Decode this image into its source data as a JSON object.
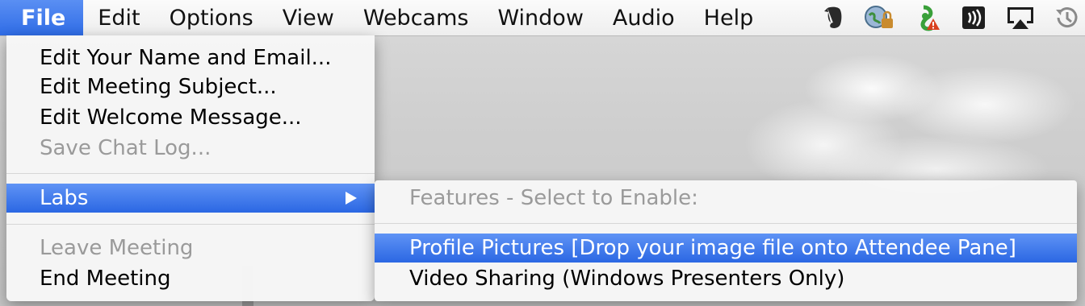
{
  "menubar": {
    "items": [
      {
        "label": "File"
      },
      {
        "label": "Edit"
      },
      {
        "label": "Options"
      },
      {
        "label": "View"
      },
      {
        "label": "Webcams"
      },
      {
        "label": "Window"
      },
      {
        "label": "Audio"
      },
      {
        "label": "Help"
      }
    ],
    "status_icons": [
      "evernote-icon",
      "network-lock-icon",
      "sync-warning-icon",
      "volume-icon",
      "airplay-icon",
      "time-machine-icon"
    ]
  },
  "file_menu": {
    "items": [
      {
        "label": "Edit Your Name and Email...",
        "enabled": true
      },
      {
        "label": "Edit Meeting Subject...",
        "enabled": true
      },
      {
        "label": "Edit Welcome Message...",
        "enabled": true
      },
      {
        "label": "Save Chat Log...",
        "enabled": false
      },
      {
        "label": "Labs",
        "enabled": true,
        "highlighted": true,
        "has_submenu": true
      },
      {
        "label": "Leave Meeting",
        "enabled": false
      },
      {
        "label": "End Meeting",
        "enabled": true
      }
    ]
  },
  "labs_submenu": {
    "header": "Features - Select to Enable:",
    "items": [
      {
        "label": "Profile Pictures  [Drop your image file onto Attendee Pane]",
        "highlighted": true
      },
      {
        "label": "Video Sharing (Windows Presenters Only)",
        "highlighted": false
      }
    ]
  },
  "colors": {
    "highlight": "#2f6ce6",
    "disabled_text": "#9a9a9a"
  }
}
